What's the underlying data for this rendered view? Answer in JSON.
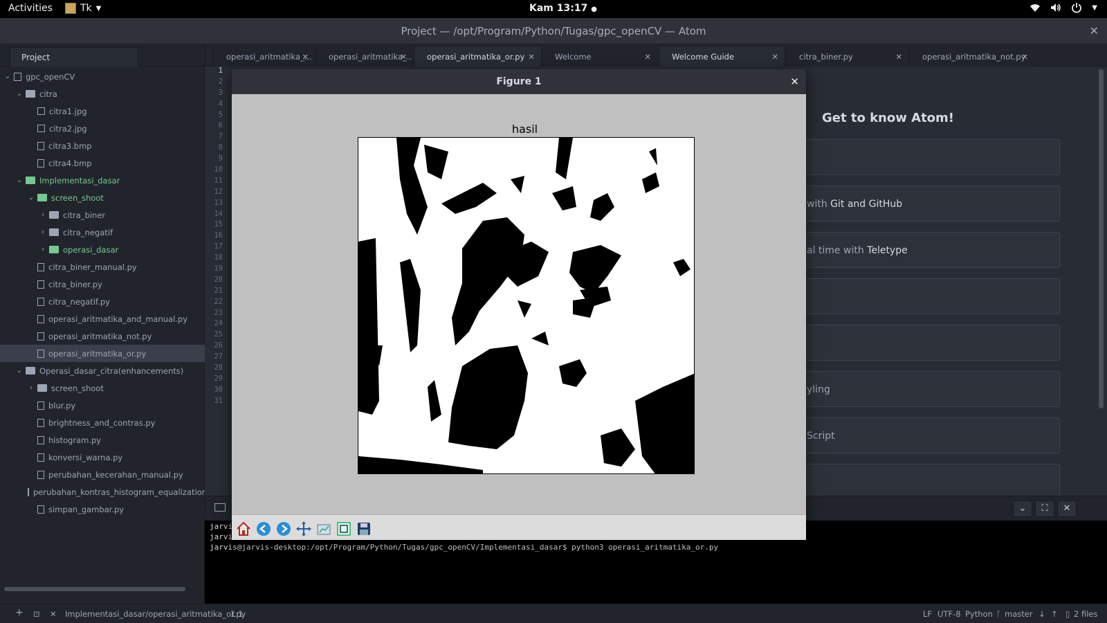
{
  "topbar": {
    "activities": "Activities",
    "app_name": "Tk",
    "clock": "Kam 13:17",
    "tray_icons": [
      "wifi-icon",
      "volume-icon",
      "power-icon"
    ]
  },
  "window": {
    "title": "Project — /opt/Program/Python/Tugas/gpc_openCV — Atom"
  },
  "tree": {
    "tab_label": "Project",
    "nodes": [
      {
        "label": "gpc_openCV",
        "kind": "repo",
        "depth": 0,
        "expanded": true
      },
      {
        "label": "citra",
        "kind": "folder",
        "depth": 1,
        "expanded": true
      },
      {
        "label": "citra1.jpg",
        "kind": "image",
        "depth": 2
      },
      {
        "label": "citra2.jpg",
        "kind": "image",
        "depth": 2
      },
      {
        "label": "citra3.bmp",
        "kind": "file",
        "depth": 2
      },
      {
        "label": "citra4.bmp",
        "kind": "file",
        "depth": 2
      },
      {
        "label": "Implementasi_dasar",
        "kind": "folder",
        "depth": 1,
        "expanded": true,
        "status": "modified"
      },
      {
        "label": "screen_shoot",
        "kind": "folder",
        "depth": 2,
        "expanded": true,
        "status": "modified"
      },
      {
        "label": "citra_biner",
        "kind": "folder",
        "depth": 3,
        "expanded": false
      },
      {
        "label": "citra_negatif",
        "kind": "folder",
        "depth": 3,
        "expanded": false
      },
      {
        "label": "operasi_dasar",
        "kind": "folder",
        "depth": 3,
        "expanded": false,
        "status": "modified"
      },
      {
        "label": "citra_biner_manual.py",
        "kind": "file",
        "depth": 2
      },
      {
        "label": "citra_biner.py",
        "kind": "file",
        "depth": 2
      },
      {
        "label": "citra_negatif.py",
        "kind": "file",
        "depth": 2
      },
      {
        "label": "operasi_aritmatika_and_manual.py",
        "kind": "file",
        "depth": 2
      },
      {
        "label": "operasi_aritmatika_not.py",
        "kind": "file",
        "depth": 2
      },
      {
        "label": "operasi_aritmatika_or.py",
        "kind": "file",
        "depth": 2,
        "selected": true
      },
      {
        "label": "Operasi_dasar_citra(enhancements)",
        "kind": "folder",
        "depth": 1,
        "expanded": true
      },
      {
        "label": "screen_shoot",
        "kind": "folder",
        "depth": 2,
        "expanded": false
      },
      {
        "label": "blur.py",
        "kind": "file",
        "depth": 2
      },
      {
        "label": "brightness_and_contras.py",
        "kind": "file",
        "depth": 2
      },
      {
        "label": "histogram.py",
        "kind": "file",
        "depth": 2
      },
      {
        "label": "konversi_warna.py",
        "kind": "file",
        "depth": 2
      },
      {
        "label": "perubahan_kecerahan_manual.py",
        "kind": "file",
        "depth": 2
      },
      {
        "label": "perubahan_kontras_histogram_equalization",
        "kind": "file",
        "depth": 2
      },
      {
        "label": "simpan_gambar.py",
        "kind": "file",
        "depth": 2
      }
    ]
  },
  "tabs": [
    {
      "label": "operasi_aritmatika_...",
      "active": false
    },
    {
      "label": "operasi_aritmatika_...",
      "active": false
    },
    {
      "label": "operasi_aritmatika_or.py",
      "active": true
    },
    {
      "label": "Welcome",
      "active": false
    },
    {
      "label": "Welcome Guide",
      "active": true
    },
    {
      "label": "citra_biner.py",
      "active": false
    },
    {
      "label": "operasi_aritmatika_not.py",
      "active": false
    }
  ],
  "gutter": {
    "line_count": 31,
    "current_line": 1
  },
  "welcome_guide": {
    "heading": "Get to know Atom!",
    "cards": [
      {
        "pre": "",
        "bold": ""
      },
      {
        "pre": "with ",
        "bold": "Git and GitHub"
      },
      {
        "pre": "al time with ",
        "bold": "Teletype"
      },
      {
        "pre": "",
        "bold": ""
      },
      {
        "pre": "",
        "bold": ""
      },
      {
        "pre": "yling",
        "bold": ""
      },
      {
        "pre": "Script",
        "bold": ""
      },
      {
        "pre": "",
        "bold": ""
      }
    ]
  },
  "terminal": {
    "lines": [
      "jarvi",
      "jarvi",
      "jarvis@jarvis-desktop:/opt/Program/Python/Tugas/gpc_openCV/Implementasi_dasar$ python3 operasi_aritmatika_or.py"
    ]
  },
  "figure": {
    "window_title": "Figure 1",
    "plot_title": "hasil",
    "toolbar": [
      "home-icon",
      "back-icon",
      "forward-icon",
      "pan-icon",
      "configure-subplots-icon",
      "zoom-rect-icon",
      "save-icon"
    ]
  },
  "statusbar": {
    "path": "Implementasi_dasar/operasi_aritmatika_or.py",
    "cursor": "1:1",
    "line_ending": "LF",
    "encoding": "UTF-8",
    "grammar": "Python",
    "branch": "master",
    "changes": "2 files"
  },
  "colors": {
    "modified_green": "#73c990",
    "editor_bg": "#282c34",
    "panel_bg": "#21252b"
  }
}
